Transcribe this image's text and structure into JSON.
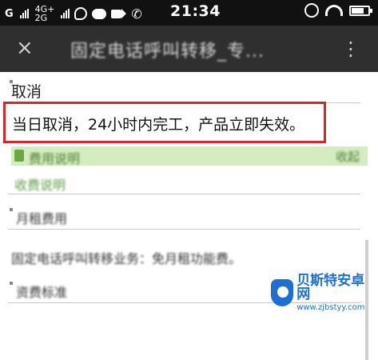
{
  "status_bar": {
    "carrier_1": "G",
    "carrier_2_top": "4G+",
    "carrier_2_bottom": "2G",
    "time": "21:34",
    "icons": [
      "signal-icon",
      "qq-icon",
      "message-icon",
      "video-icon",
      "phone-icon",
      "alarm-icon",
      "wifi-icon",
      "battery-icon"
    ]
  },
  "toolbar": {
    "close_glyph": "×",
    "title": "固定电话呼叫转移_专...",
    "more_glyph": "⋮"
  },
  "main": {
    "section_cancel_title": "取消",
    "highlighted_text": "当日取消，24小时内完工，产品立即失效。",
    "green_row_text": "费用说明",
    "green_row_action": "收起",
    "link_row_text": "收费说明",
    "monthly_title": "月租费用",
    "monthly_text": "固定电话呼叫转移业务：免月租功能费。",
    "fee_title": "资费标准"
  },
  "watermark": {
    "name": "贝斯特安卓网",
    "url": "www.zjbstyy.com"
  },
  "colors": {
    "status_bg": "#111111",
    "toolbar_bg": "#2f2f2f",
    "highlight_border": "#d8252c",
    "green_row_bg": "#d5ecc0",
    "watermark_blue": "#1d6fd1"
  }
}
